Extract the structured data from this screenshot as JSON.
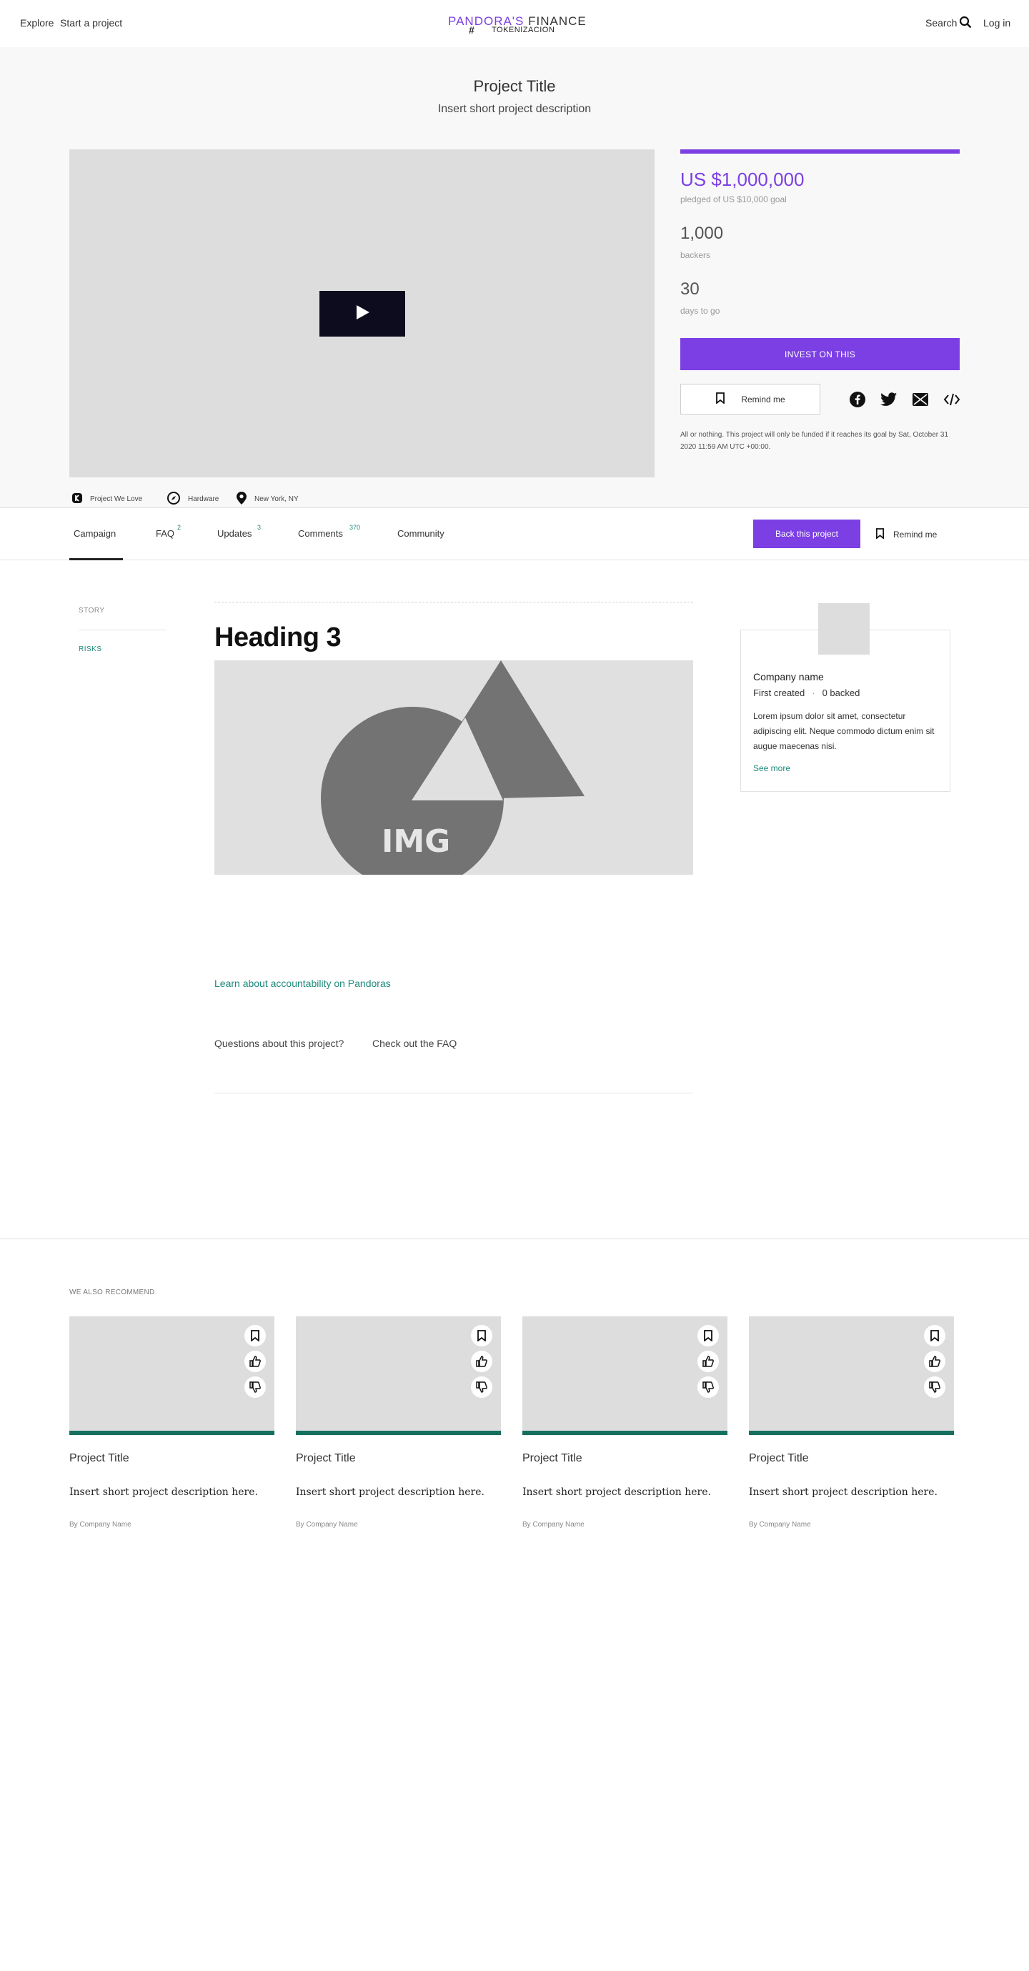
{
  "header": {
    "explore": "Explore",
    "start": "Start a project",
    "logo_brand": "PANDORA'S",
    "logo_word": "FINANCE",
    "logo_sub": "TOKENIZACION",
    "search": "Search",
    "login": "Log in"
  },
  "hero": {
    "title": "Project Title",
    "description": "Insert short project description",
    "pledged": "US $1,000,000",
    "pledged_sub": "pledged of US $10,000 goal",
    "backers": "1,000",
    "backers_label": "backers",
    "days": "30",
    "days_label": "days to go",
    "funded_fraction": 1.0,
    "invest_label": "INVEST ON THIS",
    "remind_label": "Remind me",
    "fund_note": "All or nothing. This project will only be funded if it reaches its goal by Sat, October 31 2020 11:59 AM UTC +00:00.",
    "meta": {
      "love": "Project We Love",
      "category": "Hardware",
      "location": "New York, NY"
    }
  },
  "tabs": {
    "campaign": "Campaign",
    "faq": "FAQ",
    "faq_count": "2",
    "updates": "Updates",
    "updates_count": "3",
    "comments": "Comments",
    "comments_count": "370",
    "community": "Community",
    "back_label": "Back this project",
    "remind_label": "Remind me"
  },
  "content": {
    "side_story": "STORY",
    "side_risks": "RISKS",
    "heading": "Heading 3",
    "img_label": "IMG",
    "learn_link": "Learn about accountability on Pandoras",
    "questions": "Questions about this project?",
    "faq_link": "Check out the FAQ"
  },
  "company": {
    "name": "Company name",
    "first_created": "First created",
    "backed": "0 backed",
    "description": "Lorem ipsum dolor sit amet, consectetur adipiscing elit. Neque commodo dictum enim sit augue maecenas nisi.",
    "see_more": "See more"
  },
  "recommend": {
    "label": "WE ALSO RECOMMEND",
    "cards": [
      {
        "title": "Project Title",
        "desc": "Insert short project description here.",
        "by": "By Company Name"
      },
      {
        "title": "Project Title",
        "desc": "Insert short project description here.",
        "by": "By Company Name"
      },
      {
        "title": "Project Title",
        "desc": "Insert short project description here.",
        "by": "By Company Name"
      },
      {
        "title": "Project Title",
        "desc": "Insert short project description here.",
        "by": "By Company Name"
      }
    ]
  },
  "colors": {
    "accent": "#7b3fe4",
    "teal": "#1e8a7a",
    "bar": "#15705f"
  }
}
